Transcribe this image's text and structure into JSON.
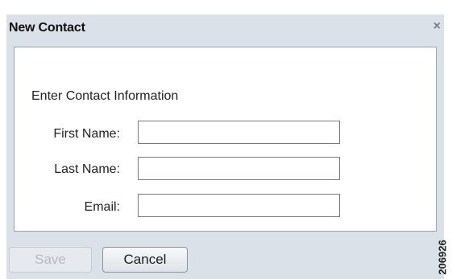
{
  "dialog": {
    "title": "New Contact",
    "close_glyph": "×",
    "close_icon": "close-icon"
  },
  "form": {
    "heading": "Enter Contact Information",
    "first_name": {
      "label": "First Name:",
      "value": ""
    },
    "last_name": {
      "label": "Last Name:",
      "value": ""
    },
    "email": {
      "label": "Email:",
      "value": ""
    }
  },
  "buttons": {
    "save_label": "Save",
    "cancel_label": "Cancel",
    "save_enabled": false
  },
  "figure_id": "206926"
}
